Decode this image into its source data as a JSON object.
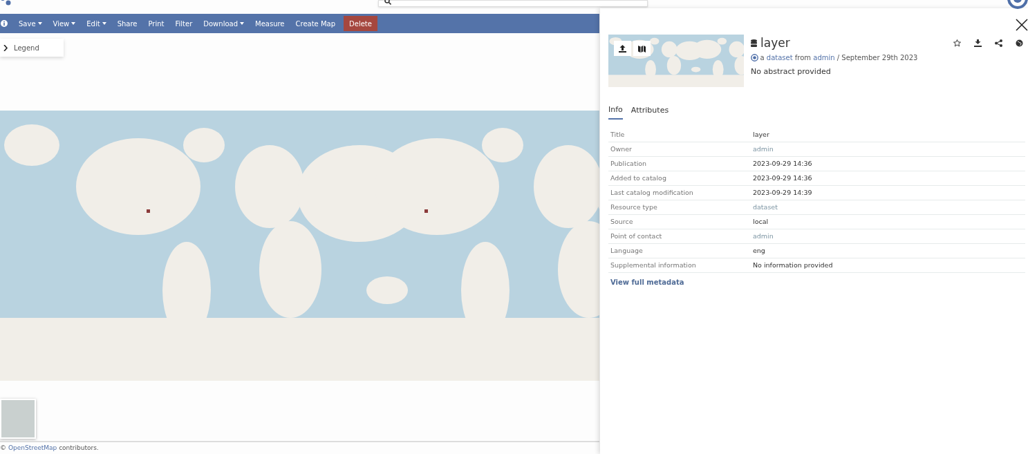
{
  "toolbar": [
    {
      "label": "Save",
      "dropdown": true,
      "kind": "plain"
    },
    {
      "label": "View",
      "dropdown": true,
      "kind": "plain"
    },
    {
      "label": "Edit",
      "dropdown": true,
      "kind": "plain"
    },
    {
      "label": "Share",
      "dropdown": false,
      "kind": "plain"
    },
    {
      "label": "Print",
      "dropdown": false,
      "kind": "plain"
    },
    {
      "label": "Filter",
      "dropdown": false,
      "kind": "plain"
    },
    {
      "label": "Download",
      "dropdown": true,
      "kind": "plain"
    },
    {
      "label": "Measure",
      "dropdown": false,
      "kind": "plain"
    },
    {
      "label": "Create Map",
      "dropdown": false,
      "kind": "plain"
    },
    {
      "label": "Delete",
      "dropdown": false,
      "kind": "danger"
    }
  ],
  "legend": {
    "label": "Legend",
    "expanded": false
  },
  "attribution": {
    "prefix": "©",
    "link": "OpenStreetMap",
    "text": "contributors."
  },
  "panel": {
    "title": "layer",
    "byline": {
      "prefix": "a",
      "type": "dataset",
      "from": "from",
      "owner": "admin",
      "date": "/ September 29th 2023"
    },
    "abstract": "No abstract provided",
    "tabs": [
      {
        "label": "Info",
        "selected": true
      },
      {
        "label": "Attributes",
        "selected": false
      }
    ],
    "rows": [
      {
        "label": "Title",
        "value": "layer",
        "kind": "text"
      },
      {
        "label": "Owner",
        "value": "admin",
        "kind": "link"
      },
      {
        "label": "Publication",
        "value": "2023-09-29 14:36",
        "kind": "text"
      },
      {
        "label": "Added to catalog",
        "value": "2023-09-29 14:36",
        "kind": "text"
      },
      {
        "label": "Last catalog modification",
        "value": "2023-09-29 14:39",
        "kind": "text"
      },
      {
        "label": "Resource type",
        "value": "dataset",
        "kind": "link"
      },
      {
        "label": "Source",
        "value": "local",
        "kind": "text"
      },
      {
        "label": "Point of contact",
        "value": "admin",
        "kind": "link"
      },
      {
        "label": "Language",
        "value": "eng",
        "kind": "text"
      },
      {
        "label": "Supplemental information",
        "value": "No information provided",
        "kind": "text"
      }
    ],
    "more_link": "View full metadata"
  }
}
